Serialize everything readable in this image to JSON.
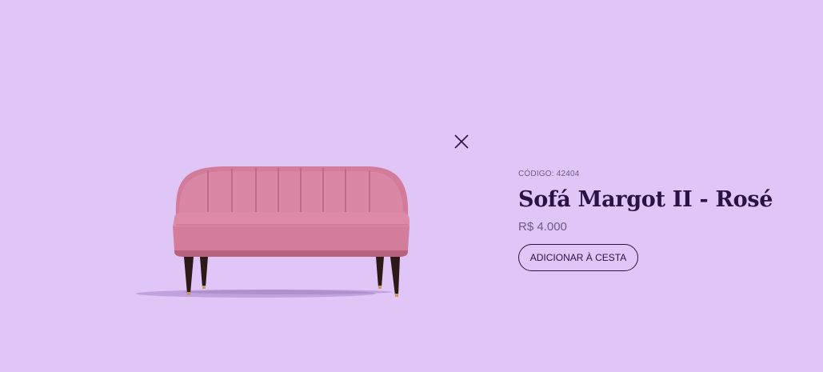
{
  "product": {
    "code_label": "CÓDIGO: 42404",
    "title": "Sofá Margot II - Rosé",
    "price": "R$ 4.000",
    "add_to_cart_label": "ADICIONAR À CESTA",
    "image_name": "sofa-image"
  },
  "icons": {
    "close": "close-icon"
  },
  "colors": {
    "background": "#dfc6f7",
    "text_primary": "#2a1247",
    "text_secondary": "#6e5a86",
    "sofa": "#d9829f"
  }
}
